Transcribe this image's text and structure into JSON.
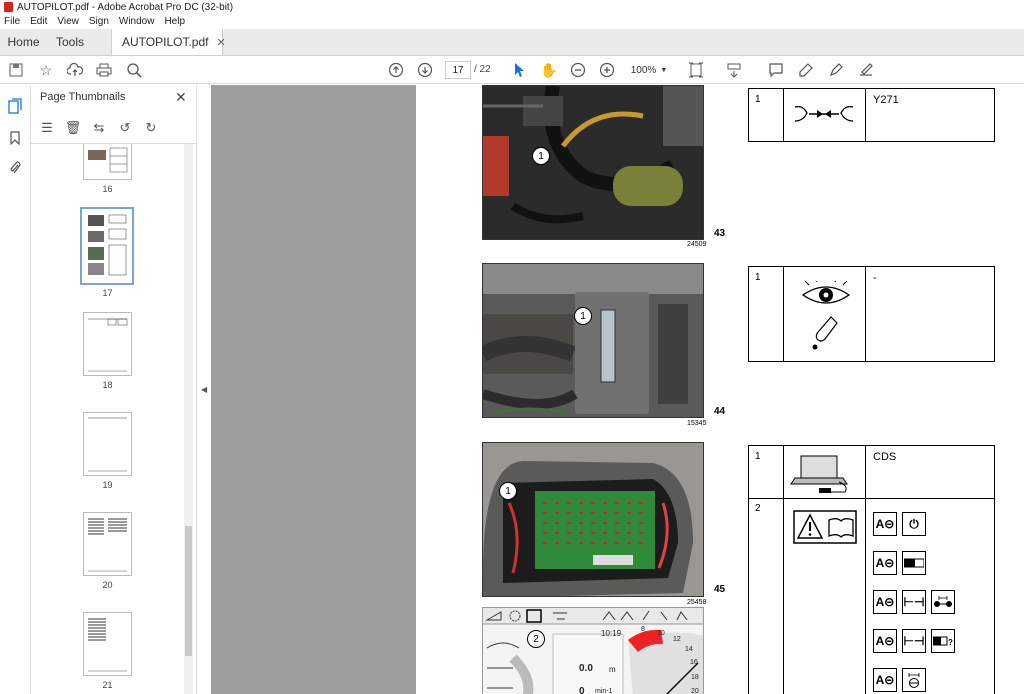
{
  "window": {
    "title": "AUTOPILOT.pdf - Adobe Acrobat Pro DC (32-bit)"
  },
  "menu": [
    "File",
    "Edit",
    "View",
    "Sign",
    "Window",
    "Help"
  ],
  "tabs": {
    "home": "Home",
    "tools": "Tools",
    "document": "AUTOPILOT.pdf"
  },
  "toolbar": {
    "current_page": "17",
    "total_pages": "/ 22",
    "zoom": "100%"
  },
  "panel": {
    "title": "Page Thumbnails"
  },
  "thumbnails": [
    {
      "label": "16"
    },
    {
      "label": "17",
      "selected": true
    },
    {
      "label": "18"
    },
    {
      "label": "19"
    },
    {
      "label": "20"
    },
    {
      "label": "21"
    }
  ],
  "document": {
    "figures": [
      {
        "number": "43",
        "code": "24509",
        "callout": "1"
      },
      {
        "number": "44",
        "code": "15345",
        "callout": "1"
      },
      {
        "number": "45",
        "code": "25458",
        "callout": "1"
      },
      {
        "callout": "2",
        "screen_values": [
          "10:19",
          "0.0",
          "m",
          "0",
          "min-1"
        ]
      }
    ],
    "tables": [
      {
        "row": "1",
        "text": "Y271"
      },
      {
        "row": "1",
        "text": "-"
      },
      {
        "row": "1",
        "text": "CDS",
        "row2": "2"
      }
    ],
    "gauge_ticks": [
      "8",
      "10",
      "12",
      "14",
      "16",
      "18",
      "20"
    ]
  }
}
